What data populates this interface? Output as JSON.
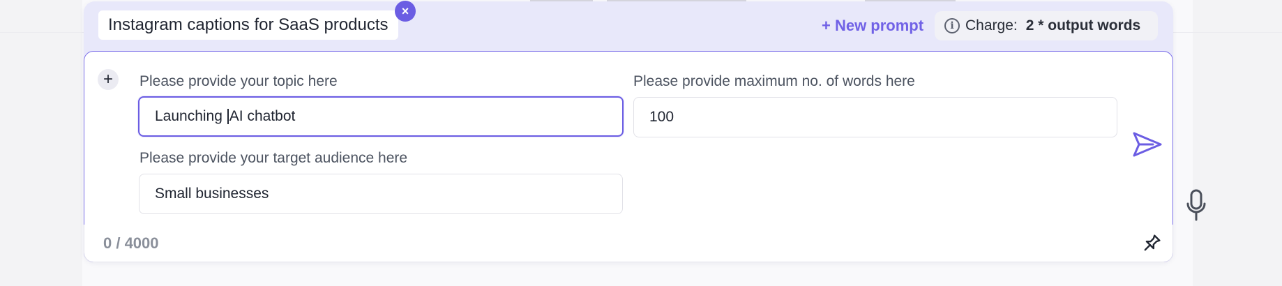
{
  "prompt": {
    "title": "Instagram captions for SaaS products",
    "close_symbol": "×"
  },
  "header": {
    "new_prompt_label": "+ New prompt",
    "charge_label": "Charge:",
    "charge_value": "2 * output words"
  },
  "icons": {
    "info": "info-icon",
    "add": "plus-icon",
    "send": "send-icon",
    "mic": "microphone-icon",
    "pin": "pin-icon",
    "close": "close-icon"
  },
  "form": {
    "add_symbol": "+",
    "fields": [
      {
        "label": "Please provide your topic here",
        "value_before_caret": "Launching ",
        "value_after_caret": "AI chatbot"
      },
      {
        "label": "Please provide maximum no. of words here",
        "value": "100"
      },
      {
        "label": "Please provide your target audience here",
        "value": "Small businesses"
      }
    ]
  },
  "footer": {
    "char_count": "0 / 4000"
  },
  "colors": {
    "accent": "#6b5de3",
    "card_bg": "#e8e8fa",
    "text": "#1f2430",
    "muted": "#8a8f9a"
  }
}
